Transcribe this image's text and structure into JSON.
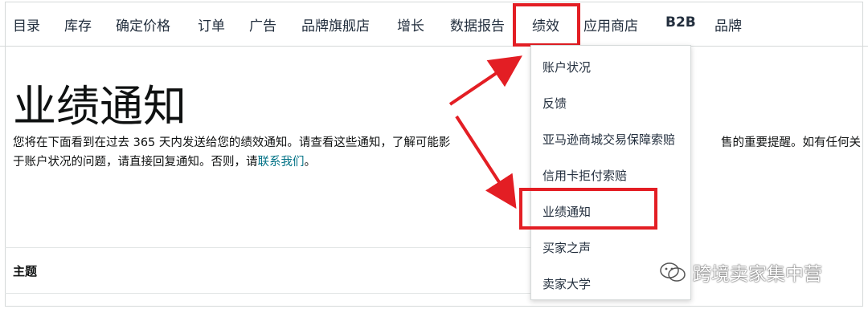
{
  "nav": {
    "items": [
      "目录",
      "库存",
      "确定价格",
      "订单",
      "广告",
      "品牌旗舰店",
      "增长",
      "数据报告",
      "绩效",
      "应用商店",
      "B2B",
      "品牌"
    ],
    "active": "绩效"
  },
  "page": {
    "title": "业绩通知",
    "desc_text": "您将在下面看到在过去 365 天内发送给您的绩效通知。请查看这些通知，了解可能影",
    "desc_text_right": "售的重要提醒。如有任何关",
    "desc_text_line2": "于账户状况的问题，请直接回复通知。否则，请",
    "contact_link": "联系我们",
    "desc_end": "。",
    "section_header": "主题"
  },
  "dropdown": {
    "items": [
      "账户状况",
      "反馈",
      "亚马逊商城交易保障索赔",
      "信用卡拒付索赔",
      "业绩通知",
      "买家之声",
      "卖家大学"
    ],
    "highlighted": "业绩通知"
  },
  "watermark": {
    "text": "跨境卖家集中营",
    "icon": "wechat-icon"
  },
  "colors": {
    "highlight": "#e31e24",
    "link": "#007185",
    "text": "#0f1111"
  }
}
